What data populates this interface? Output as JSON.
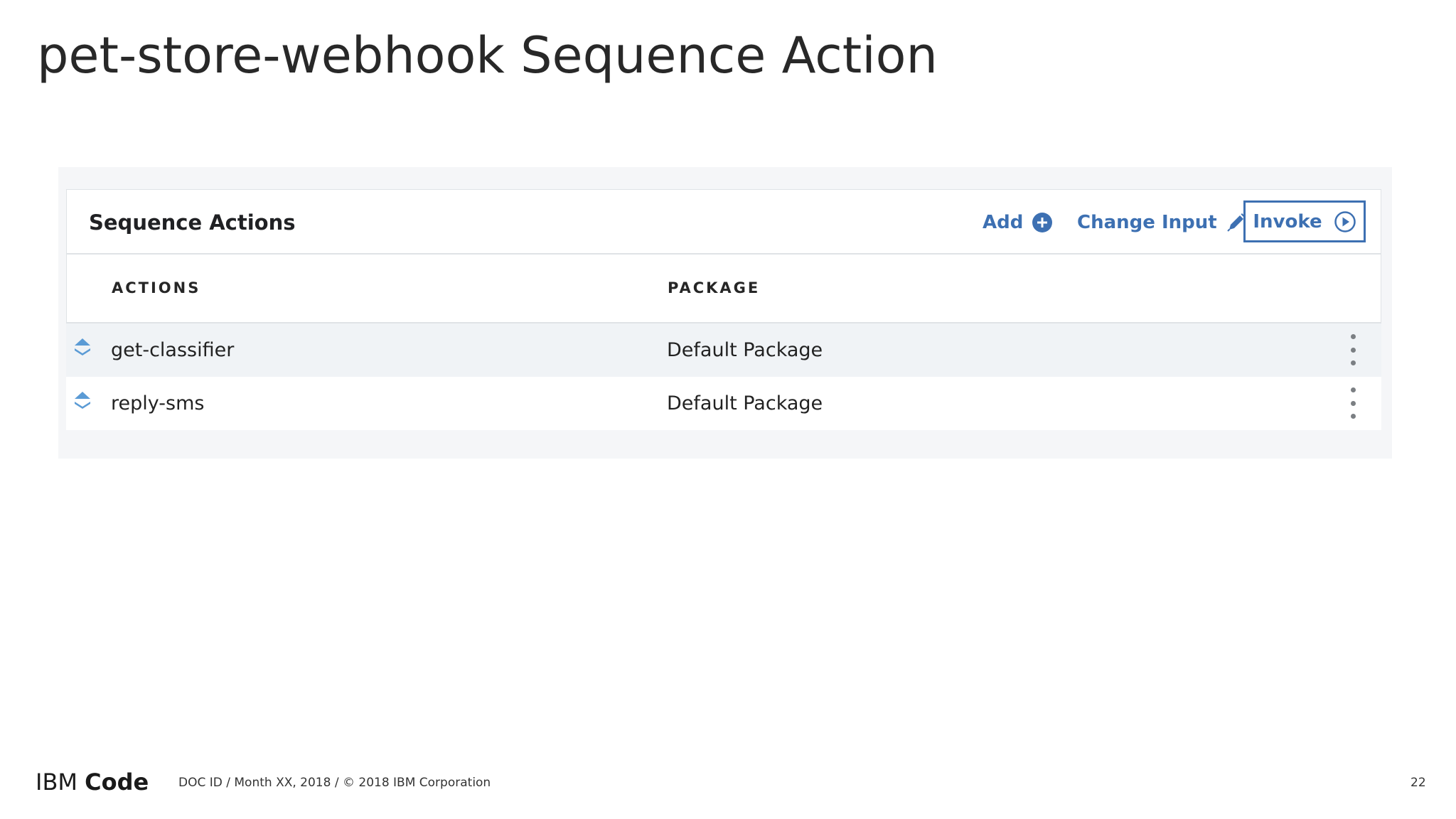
{
  "slide": {
    "title": "pet-store-webhook Sequence Action",
    "page_number": "22"
  },
  "panel": {
    "title": "Sequence Actions",
    "add_label": "Add",
    "change_input_label": "Change Input",
    "invoke_label": "Invoke",
    "icons": {
      "add": "plus-circle-icon",
      "change_input": "pencil-icon",
      "invoke": "play-circle-icon",
      "drag": "sort-arrows-icon",
      "row_menu": "vertical-dots-icon"
    }
  },
  "table": {
    "columns": [
      "ACTIONS",
      "PACKAGE"
    ],
    "rows": [
      {
        "action": "get-classifier",
        "package": "Default Package"
      },
      {
        "action": "reply-sms",
        "package": "Default Package"
      }
    ]
  },
  "footer": {
    "brand_light": "IBM",
    "brand_bold": "Code",
    "doc_info": "DOC ID / Month XX, 2018 / © 2018 IBM Corporation"
  },
  "colors": {
    "accent": "#3d70b2",
    "drag_handle": "#5b9bd5",
    "row_highlight": "#f0f3f6",
    "panel_background": "#f5f6f8"
  }
}
